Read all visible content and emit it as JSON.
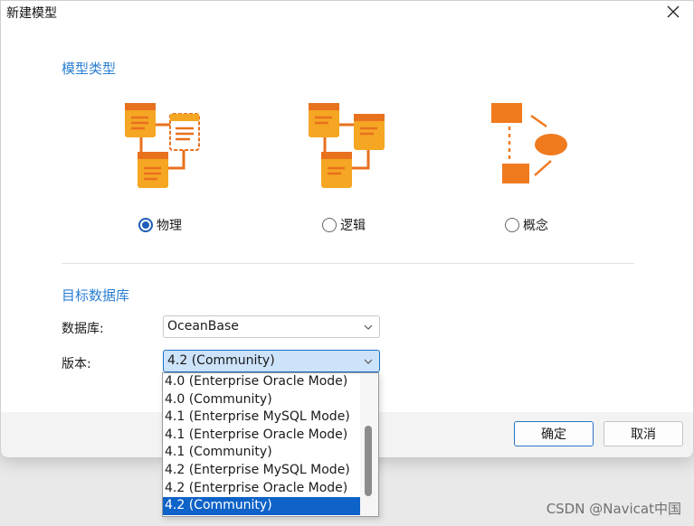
{
  "window": {
    "title": "新建模型",
    "close_icon": "close-icon"
  },
  "model_type": {
    "section_title": "模型类型",
    "options": [
      {
        "label": "物理",
        "selected": true,
        "icon": "physical-model-icon"
      },
      {
        "label": "逻辑",
        "selected": false,
        "icon": "logical-model-icon"
      },
      {
        "label": "概念",
        "selected": false,
        "icon": "conceptual-model-icon"
      }
    ]
  },
  "target_db": {
    "section_title": "目标数据库",
    "database_label": "数据库:",
    "database_value": "OceanBase",
    "version_label": "版本:",
    "version_value": "4.2 (Community)"
  },
  "version_dropdown": {
    "options": [
      "4.0 (Enterprise Oracle Mode)",
      "4.0 (Community)",
      "4.1 (Enterprise MySQL Mode)",
      "4.1 (Enterprise Oracle Mode)",
      "4.1 (Community)",
      "4.2 (Enterprise MySQL Mode)",
      "4.2 (Enterprise Oracle Mode)",
      "4.2 (Community)"
    ],
    "selected_index": 7
  },
  "footer": {
    "ok_label": "确定",
    "cancel_label": "取消"
  },
  "watermark": "CSDN @Navicat中国",
  "colors": {
    "accent": "#2b7fd4",
    "icon_orange": "#f5a623",
    "icon_dark_orange": "#e8711e",
    "selection": "#0e62c8"
  }
}
